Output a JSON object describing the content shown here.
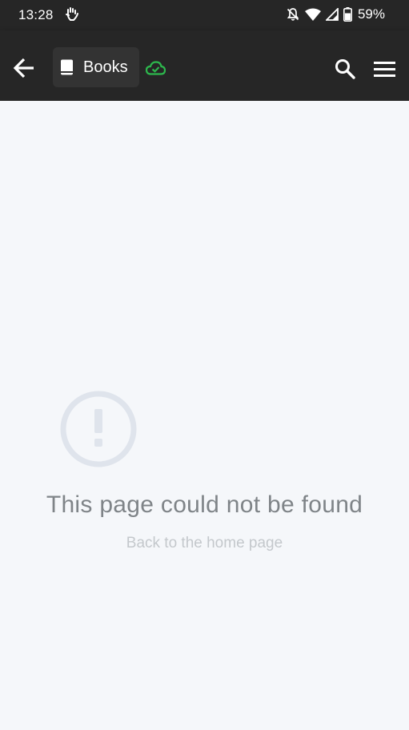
{
  "status_bar": {
    "time": "13:28",
    "battery_percent": "59%",
    "icons": [
      "hand-gesture-icon",
      "notifications-off-icon",
      "wifi-icon",
      "cell-signal-icon",
      "battery-icon"
    ]
  },
  "app_bar": {
    "back_icon": "arrow-left-icon",
    "section_icon": "book-icon",
    "section_label": "Books",
    "sync_icon": "cloud-check-icon",
    "search_icon": "search-icon",
    "menu_icon": "hamburger-menu-icon"
  },
  "main": {
    "alert_icon": "exclamation-circle-icon",
    "title": "This page could not be found",
    "home_link": "Back to the home page"
  },
  "colors": {
    "bar_background": "#262626",
    "page_background": "#f5f7fa",
    "sync_ok": "#2db84d",
    "alert_icon": "#dfe4ec",
    "title_text": "#7f8488",
    "link_text": "#c4c8cc"
  }
}
